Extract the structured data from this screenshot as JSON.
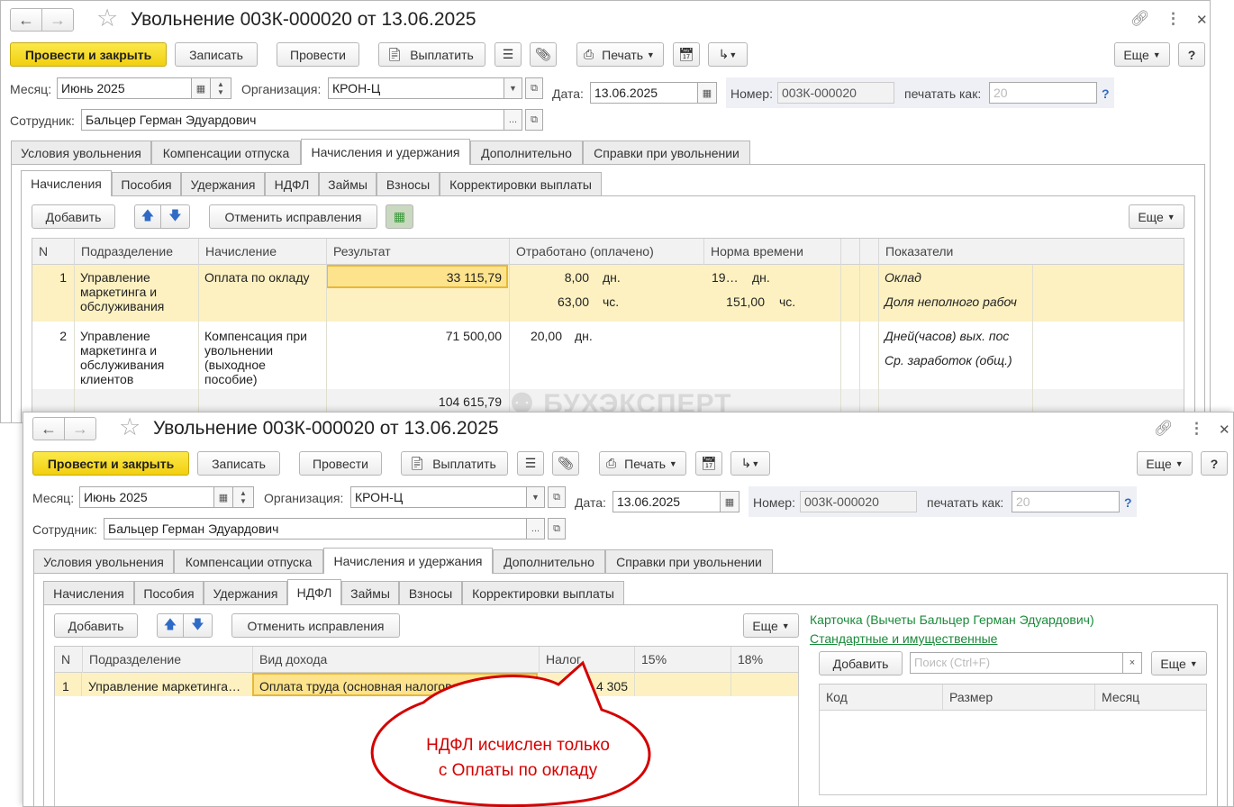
{
  "window": {
    "title": "Увольнение 003К-000020 от 13.06.2025"
  },
  "toolbar": {
    "post_close": "Провести и закрыть",
    "save": "Записать",
    "post": "Провести",
    "pay": "Выплатить",
    "print": "Печать",
    "more": "Еще",
    "help": "?"
  },
  "header": {
    "month_label": "Месяц:",
    "month_value": "Июнь 2025",
    "org_label": "Организация:",
    "org_value": "КРОН-Ц",
    "date_label": "Дата:",
    "date_value": "13.06.2025",
    "number_label": "Номер:",
    "number_value": "003К-000020",
    "print_as_label": "печатать как:",
    "print_as_placeholder": "20",
    "help_mark": "?",
    "employee_label": "Сотрудник:",
    "employee_value": "Бальцер Герман Эдуардович"
  },
  "main_tabs": [
    "Условия увольнения",
    "Компенсации отпуска",
    "Начисления и удержания",
    "Дополнительно",
    "Справки при увольнении"
  ],
  "sub_tabs": [
    "Начисления",
    "Пособия",
    "Удержания",
    "НДФЛ",
    "Займы",
    "Взносы",
    "Корректировки выплаты"
  ],
  "grid_toolbar": {
    "add": "Добавить",
    "cancel_corrections": "Отменить исправления",
    "more": "Еще"
  },
  "accruals": {
    "columns": [
      "N",
      "Подразделение",
      "Начисление",
      "Результат",
      "Отработано (оплачено)",
      "Норма времени",
      "Показатели"
    ],
    "rows": [
      {
        "n": "1",
        "dept_lines": [
          "Управление",
          "маркетинга и",
          "обслуживания"
        ],
        "accrual_lines": [
          "Оплата по окладу"
        ],
        "result": "33 115,79",
        "worked_1": "8,00",
        "unit_1": "дн.",
        "norm_1": "19…",
        "norm_unit_1": "дн.",
        "worked_2": "63,00",
        "unit_2": "чс.",
        "norm_2": "151,00",
        "norm_unit_2": "чс.",
        "indicators": [
          "Оклад",
          "Доля неполного рабоч"
        ]
      },
      {
        "n": "2",
        "dept_lines": [
          "Управление",
          "маркетинга и",
          "обслуживания",
          "клиентов"
        ],
        "accrual_lines": [
          "Компенсация при",
          "увольнении",
          "(выходное",
          "пособие)"
        ],
        "result": "71 500,00",
        "worked_1": "20,00",
        "unit_1": "дн.",
        "indicators": [
          "Дней(часов) вых. пос",
          "Ср. заработок (общ.)"
        ]
      }
    ],
    "total": "104 615,79"
  },
  "ndfl": {
    "columns": [
      "N",
      "Подразделение",
      "Вид дохода",
      "Налог",
      "15%",
      "18%"
    ],
    "rows": [
      {
        "n": "1",
        "dept": "Управление маркетинга…",
        "income_type": "Оплата труда (основная налоговая база)",
        "tax": "4 305"
      }
    ]
  },
  "deductions": {
    "card_link": "Карточка (Вычеты Бальцер Герман Эдуардович)",
    "standard_link": "Стандартные и имущественные",
    "add": "Добавить",
    "search_placeholder": "Поиск (Ctrl+F)",
    "more": "Еще",
    "columns": [
      "Код",
      "Размер",
      "Месяц"
    ]
  },
  "watermark": "БУХЭКСПЕРТ",
  "callout": {
    "line1": "НДФЛ исчислен только",
    "line2": "с Оплаты по окладу",
    "color": "#d40000"
  }
}
